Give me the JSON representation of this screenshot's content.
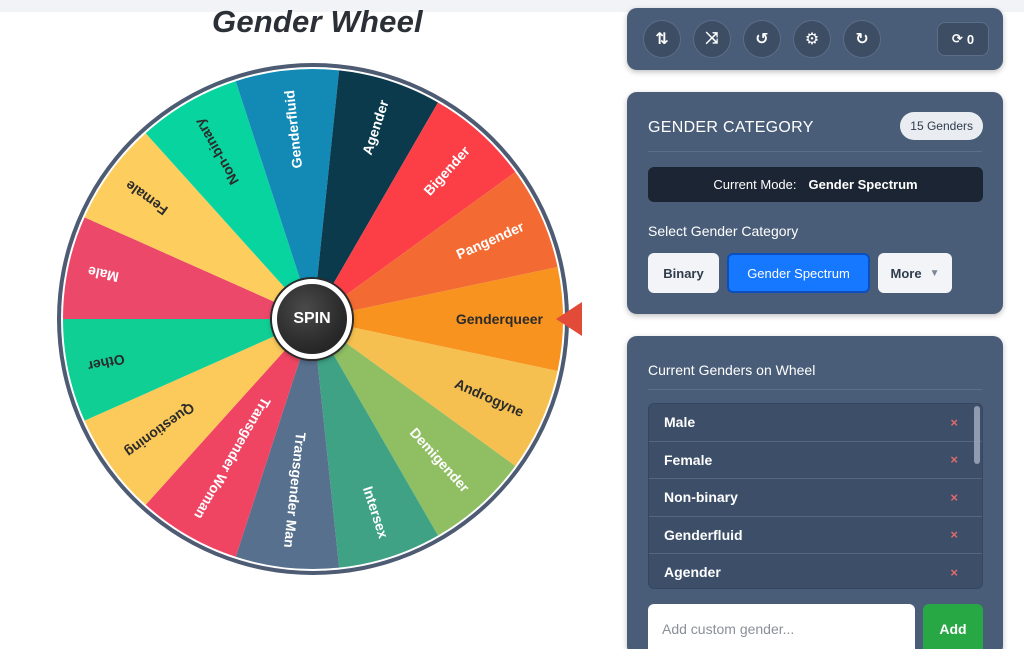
{
  "title": "Gender Wheel",
  "spin_label": "SPIN",
  "wheel": {
    "segments": [
      {
        "label": "Genderqueer",
        "color": "#f7931e",
        "text_color": "#2b2b2b"
      },
      {
        "label": "Androgyne",
        "color": "#f5c04f",
        "text_color": "#2b2b2b"
      },
      {
        "label": "Demigender",
        "color": "#8fbe63",
        "text_color": "#ffffff"
      },
      {
        "label": "Intersex",
        "color": "#3fa284",
        "text_color": "#ffffff"
      },
      {
        "label": "Transgender Man",
        "color": "#56708d",
        "text_color": "#ffffff"
      },
      {
        "label": "Transgender Woman",
        "color": "#ef4563",
        "text_color": "#ffffff"
      },
      {
        "label": "Questioning",
        "color": "#fcca5a",
        "text_color": "#2b2b2b"
      },
      {
        "label": "Other",
        "color": "#0fcf95",
        "text_color": "#2b2b2b"
      },
      {
        "label": "Male",
        "color": "#ec4869",
        "text_color": "#ffffff"
      },
      {
        "label": "Female",
        "color": "#fdcd5e",
        "text_color": "#2b2b2b"
      },
      {
        "label": "Non-binary",
        "color": "#07d49f",
        "text_color": "#2b2b2b"
      },
      {
        "label": "Genderfluid",
        "color": "#128ab5",
        "text_color": "#ffffff"
      },
      {
        "label": "Agender",
        "color": "#0b3a4d",
        "text_color": "#ffffff"
      },
      {
        "label": "Bigender",
        "color": "#fc3f47",
        "text_color": "#ffffff"
      },
      {
        "label": "Pangender",
        "color": "#f36b32",
        "text_color": "#ffffff"
      }
    ],
    "rim_color": "#4d5b73"
  },
  "toolbar": {
    "buttons": [
      {
        "name": "sort-button",
        "icon": "sort-icon",
        "glyph": "⇅"
      },
      {
        "name": "shuffle-button",
        "icon": "shuffle-icon",
        "glyph": "⤨"
      },
      {
        "name": "history-button",
        "icon": "history-icon",
        "glyph": "↺"
      },
      {
        "name": "settings-button",
        "icon": "gear-icon",
        "glyph": "⚙"
      },
      {
        "name": "reset-button",
        "icon": "redo-icon",
        "glyph": "↻"
      }
    ],
    "spin_count": "0"
  },
  "category": {
    "header": "GENDER CATEGORY",
    "count_badge": "15 Genders",
    "mode_label": "Current Mode:",
    "mode_value": "Gender Spectrum",
    "select_label": "Select Gender Category",
    "options": [
      "Binary",
      "Gender Spectrum",
      "More"
    ],
    "active": "Gender Spectrum"
  },
  "genders": {
    "header": "Current Genders on Wheel",
    "items": [
      "Male",
      "Female",
      "Non-binary",
      "Genderfluid",
      "Agender"
    ],
    "remove_glyph": "×",
    "input_placeholder": "Add custom gender...",
    "add_label": "Add"
  },
  "colors": {
    "panel": "#4a5d78",
    "active_button": "#1677ff",
    "add_button": "#27a844"
  }
}
